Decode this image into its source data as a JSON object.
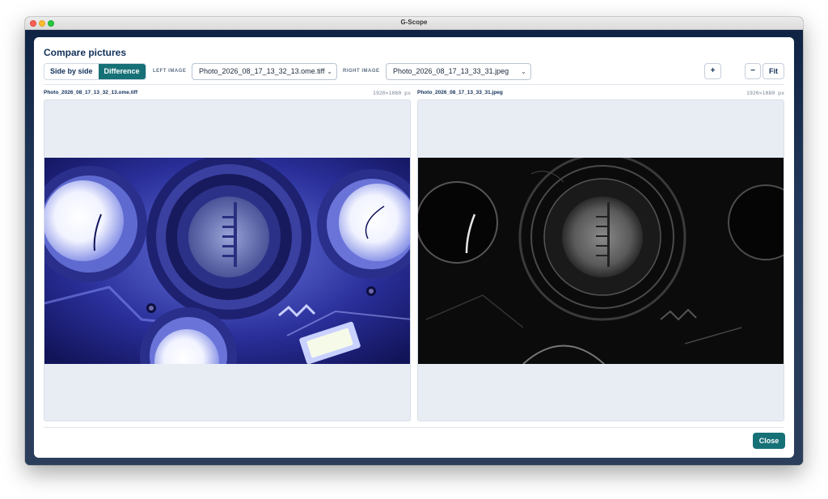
{
  "window": {
    "title": "G-Scope"
  },
  "dialog": {
    "title": "Compare pictures",
    "modes": [
      {
        "label": "Side by side",
        "active": false
      },
      {
        "label": "Difference",
        "active": true
      }
    ],
    "left_image_label": "LEFT IMAGE",
    "left_image_selected": "Photo_2026_08_17_13_32_13.ome.tiff",
    "right_image_label": "RIGHT IMAGE",
    "right_image_selected": "Photo_2026_08_17_13_33_31.jpeg",
    "zoom_in_label": "+",
    "zoom_out_label": "−",
    "fit_label": "Fit",
    "close_label": "Close"
  },
  "panes": {
    "left": {
      "filename": "Photo_2026_08_17_13_32_13.ome.tiff",
      "dimensions": "1920×1080 px"
    },
    "right": {
      "filename": "Photo_2026_08_17_13_33_31.jpeg",
      "dimensions": "1920×1080 px"
    }
  },
  "colors": {
    "accent": "#167177",
    "title_text": "#12315a",
    "backdrop": "#1c2f4c",
    "pane_bg": "#e8edf4"
  }
}
